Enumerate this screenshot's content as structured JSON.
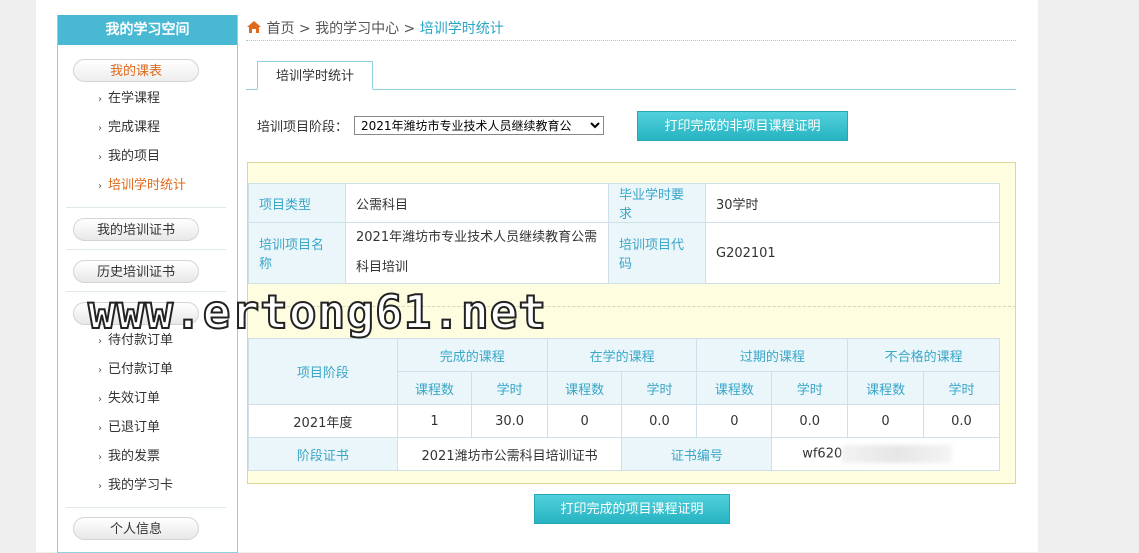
{
  "sidebar": {
    "title": "我的学习空间",
    "sections": {
      "schedule": "我的课表",
      "cert": "我的培训证书",
      "history": "历史培训证书",
      "personal": "个人信息"
    },
    "schedule_items": [
      "在学课程",
      "完成课程",
      "我的项目",
      "培训学时统计"
    ],
    "order_items": [
      "待付款订单",
      "已付款订单",
      "失效订单",
      "已退订单",
      "我的发票",
      "我的学习卡"
    ]
  },
  "breadcrumb": {
    "home": "首页",
    "sep": ">",
    "level2": "我的学习中心",
    "current": "培训学时统计"
  },
  "tab": {
    "label": "培训学时统计"
  },
  "filter": {
    "label": "培训项目阶段：",
    "selected": "2021年潍坊市专业技术人员继续教育公"
  },
  "buttons": {
    "print_non_project": "打印完成的非项目课程证明",
    "print_project": "打印完成的项目课程证明"
  },
  "project_info": {
    "type_label": "项目类型",
    "type_value": "公需科目",
    "req_label": "毕业学时要求",
    "req_value": "30学时",
    "name_label": "培训项目名称",
    "name_value": "2021年潍坊市专业技术人员继续教育公需科目培训",
    "code_label": "培训项目代码",
    "code_value": "G202101"
  },
  "stats": {
    "stage_header": "项目阶段",
    "groups": [
      "完成的课程",
      "在学的课程",
      "过期的课程",
      "不合格的课程"
    ],
    "sub_count": "课程数",
    "sub_hours": "学时",
    "row": {
      "stage": "2021年度",
      "values": [
        "1",
        "30.0",
        "0",
        "0.0",
        "0",
        "0.0",
        "0",
        "0.0"
      ]
    },
    "cert_label": "阶段证书",
    "cert_value": "2021潍坊市公需科目培训证书",
    "certno_label": "证书编号",
    "certno_value": "wf620"
  },
  "watermark": "www.ertong61.net",
  "colors": {
    "accent": "#49b8d3",
    "active": "#e06a1c",
    "panel": "#fffde0"
  }
}
